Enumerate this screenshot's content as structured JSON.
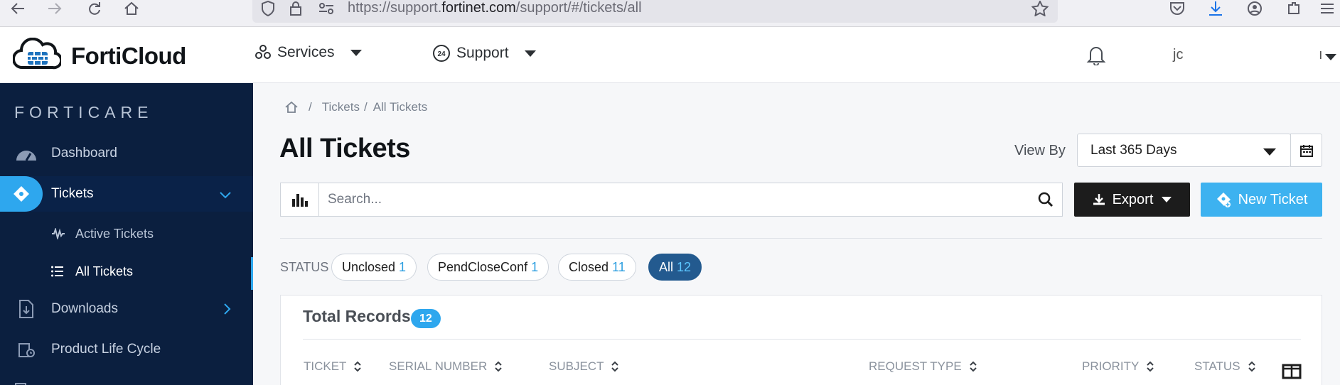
{
  "browser": {
    "url_prefix": "https://support.",
    "url_domain": "fortinet.com",
    "url_suffix": "/support/#/tickets/all"
  },
  "header": {
    "brand": "FortiCloud",
    "nav": [
      {
        "label": "Services",
        "icon": "services-icon"
      },
      {
        "label": "Support",
        "icon": "support-24-icon"
      }
    ],
    "user_initials": "jc",
    "user_trailing": "ı"
  },
  "sidebar": {
    "brand": "FORTICARE",
    "items": [
      {
        "label": "Dashboard",
        "icon": "dashboard-gauge-icon"
      },
      {
        "label": "Tickets",
        "icon": "ticket-icon",
        "active": true
      },
      {
        "label": "Active Tickets",
        "icon": "pulse-icon"
      },
      {
        "label": "All Tickets",
        "icon": "list-icon",
        "current": true
      },
      {
        "label": "Downloads",
        "icon": "download-file-icon"
      },
      {
        "label": "Product Life Cycle",
        "icon": "lifecycle-icon"
      }
    ]
  },
  "breadcrumb": {
    "items": [
      "Tickets",
      "All Tickets"
    ]
  },
  "page": {
    "title": "All Tickets",
    "view_by_label": "View By",
    "view_by_value": "Last 365 Days"
  },
  "toolbar": {
    "search_placeholder": "Search...",
    "export_label": "Export",
    "new_ticket_label": "New Ticket"
  },
  "status_filter": {
    "label": "STATUS",
    "chips": [
      {
        "label": "Unclosed",
        "count": "1"
      },
      {
        "label": "PendCloseConf",
        "count": "1"
      },
      {
        "label": "Closed",
        "count": "11"
      },
      {
        "label": "All",
        "count": "12",
        "selected": true
      }
    ]
  },
  "records": {
    "title": "Total Records",
    "count": "12",
    "columns": [
      "TICKET",
      "SERIAL NUMBER",
      "SUBJECT",
      "REQUEST TYPE",
      "PRIORITY",
      "STATUS"
    ]
  },
  "colors": {
    "sidebar_bg": "#0b1f3f",
    "accent": "#2ea7ee",
    "selected_chip": "#235a8f",
    "export_bg": "#1c1c1c"
  }
}
